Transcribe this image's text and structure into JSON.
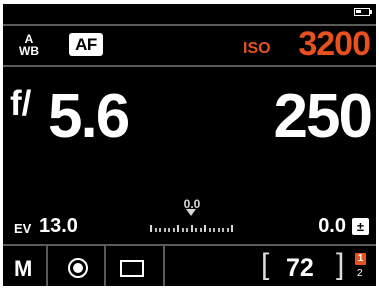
{
  "status": {
    "battery_icon": "battery-icon",
    "battery_level": 0.4
  },
  "top_row": {
    "white_balance": {
      "line1": "A",
      "line2": "WB"
    },
    "focus_mode": "AF",
    "iso": {
      "label": "ISO",
      "value": "3200",
      "color": "#e8501e"
    }
  },
  "exposure": {
    "aperture_prefix": "f/",
    "aperture": "5.6",
    "shutter": "250"
  },
  "ev_row": {
    "ev_label": "EV",
    "ev_value": "13.0",
    "meter_value": "0.0",
    "exposure_comp": "0.0",
    "exposure_comp_icon": "±"
  },
  "bottom_row": {
    "mode": "M",
    "drive_icon": "record-icon",
    "format_icon": "frame-icon",
    "bracket_open": "[",
    "shots_remaining": "72",
    "bracket_close": "]",
    "card_slot_active": "1",
    "card_slot_secondary": "2"
  }
}
